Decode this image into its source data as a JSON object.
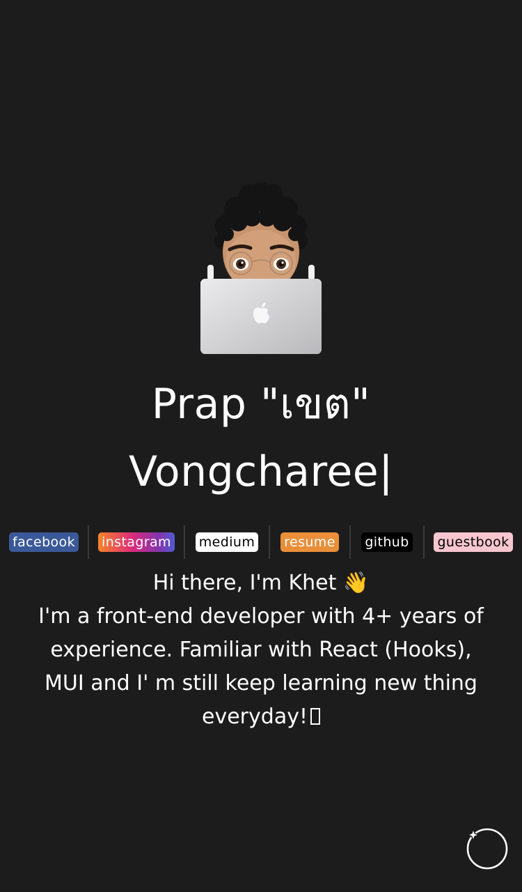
{
  "avatar": {
    "icon": "memoji-laptop-icon",
    "alt": "Memoji avatar behind laptop"
  },
  "name": {
    "first": "Prap",
    "nickname": "\"เขต\"",
    "last": "Vongcharee",
    "cursor": "|"
  },
  "links": [
    {
      "label": "facebook",
      "color": "#3b5998"
    },
    {
      "label": "instagram",
      "color": "#dd2a7b"
    },
    {
      "label": "medium",
      "color": "#ffffff"
    },
    {
      "label": "resume",
      "color": "#e98f3a"
    },
    {
      "label": "github",
      "color": "#000000"
    },
    {
      "label": "guestbook",
      "color": "#f8c6cf"
    }
  ],
  "intro": {
    "greeting": "Hi there, I'm Khet",
    "wave_emoji": "👋",
    "body": "I'm a front-end developer with 4+ years of experience. Familiar with React (Hooks), MUI and I' m still keep learning new thing everyday!"
  },
  "theme_toggle": {
    "icon": "moon-star-icon"
  },
  "colors": {
    "background": "#1c1c1c",
    "text": "#ffffff",
    "separator": "#3a3a3a"
  }
}
